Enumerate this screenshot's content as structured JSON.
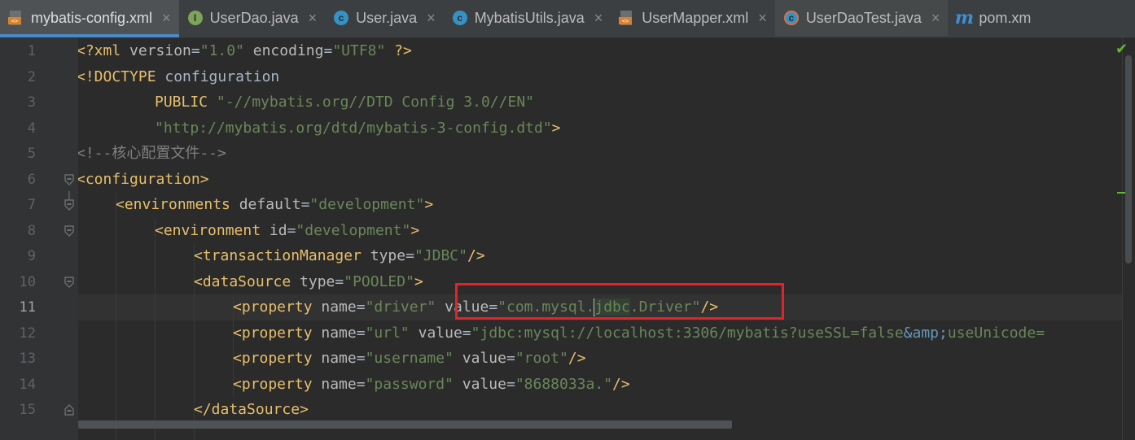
{
  "tabs": [
    {
      "label": "mybatis-config.xml",
      "icon": "xml-file-icon",
      "active": true
    },
    {
      "label": "UserDao.java",
      "icon": "interface-icon",
      "active": false
    },
    {
      "label": "User.java",
      "icon": "class-icon",
      "active": false
    },
    {
      "label": "MybatisUtils.java",
      "icon": "class-icon",
      "active": false
    },
    {
      "label": "UserMapper.xml",
      "icon": "xml-file-icon",
      "active": false
    },
    {
      "label": "UserDaoTest.java",
      "icon": "test-class-icon",
      "active": false
    },
    {
      "label": "pom.xm",
      "icon": "maven-icon",
      "active": false
    }
  ],
  "close_glyph": "×",
  "line_numbers": [
    "1",
    "2",
    "3",
    "4",
    "5",
    "6",
    "7",
    "8",
    "9",
    "10",
    "11",
    "12",
    "13",
    "14",
    "15"
  ],
  "code": {
    "l1": {
      "a": "<?xml ",
      "b": "version",
      "c": "=",
      "d": "\"1.0\"",
      "e": " encoding",
      "f": "=",
      "g": "\"UTF8\"",
      "h": " ?>"
    },
    "l2": {
      "a": "<!DOCTYPE ",
      "b": "configuration"
    },
    "l3": {
      "a": "PUBLIC ",
      "b": "\"-//mybatis.org//DTD Config 3.0//EN\""
    },
    "l4": {
      "a": "\"http://mybatis.org/dtd/mybatis-3-config.dtd\"",
      "b": ">"
    },
    "l5": {
      "a": "<!--核心配置文件-->"
    },
    "l6": {
      "a": "<configuration>"
    },
    "l7": {
      "a": "<environments ",
      "b": "default",
      "c": "=",
      "d": "\"development\"",
      "e": ">"
    },
    "l8": {
      "a": "<environment ",
      "b": "id",
      "c": "=",
      "d": "\"development\"",
      "e": ">"
    },
    "l9": {
      "a": "<transactionManager ",
      "b": "type",
      "c": "=",
      "d": "\"JDBC\"",
      "e": "/>"
    },
    "l10": {
      "a": "<dataSource ",
      "b": "type",
      "c": "=",
      "d": "\"POOLED\"",
      "e": ">"
    },
    "l11": {
      "a": "<property ",
      "b": "name",
      "c": "=",
      "d": "\"driver\"",
      "e": " value",
      "f": "=",
      "g": "\"com.mysql.",
      "h": "jdbc",
      "i": ".Driver\"",
      "j": "/>"
    },
    "l12": {
      "a": "<property ",
      "b": "name",
      "c": "=",
      "d": "\"url\"",
      "e": " value",
      "f": "=",
      "g": "\"jdbc:mysql://localhost:3306/mybatis?useSSL=false",
      "h": "&amp;",
      "i": "useUnicode="
    },
    "l13": {
      "a": "<property ",
      "b": "name",
      "c": "=",
      "d": "\"username\"",
      "e": " value",
      "f": "=",
      "g": "\"root\"",
      "h": "/>"
    },
    "l14": {
      "a": "<property ",
      "b": "name",
      "c": "=",
      "d": "\"password\"",
      "e": " value",
      "f": "=",
      "g": "\"8688033a.\"",
      "h": "/>"
    },
    "l15": {
      "a": "</dataSource>"
    }
  },
  "status": {
    "check_glyph": "✔"
  }
}
